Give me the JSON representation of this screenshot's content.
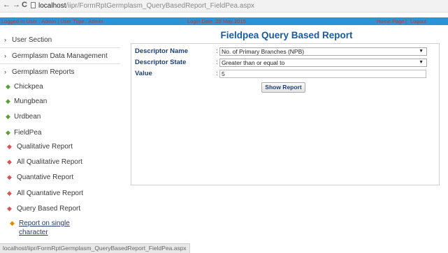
{
  "browser": {
    "back_icon": "back-arrow-icon",
    "forward_icon": "forward-arrow-icon",
    "reload_icon": "reload-icon",
    "back_glyph": "←",
    "forward_glyph": "→",
    "reload_glyph": "C",
    "url_host": "localhost",
    "url_path": "/iipr/FormRptGermplasm_QueryBasedReport_FieldPea.aspx"
  },
  "header": {
    "logged_in": "Logged In User : Admin | User Type : Admin",
    "login_date": "Login Date :29 May 2015",
    "home_link": "Home Page",
    "separator": "|",
    "logout_link": "Logout"
  },
  "sidebar": {
    "user_section": "User Section",
    "germplasm_data_management": "Germplasm Data Management",
    "germplasm_reports": "Germplasm Reports",
    "crops": [
      "Chickpea",
      "Mungbean",
      "Urdbean",
      "FieldPea"
    ],
    "fieldpea_reports": [
      "Qualitative Report",
      "All Qualitative Report",
      "Quantative Report",
      "All Quantative Report",
      "Query Based Report"
    ],
    "report_on_single_line1": "Report on single",
    "report_on_single_line2": "character"
  },
  "main": {
    "title": "Fieldpea Query Based Report",
    "descriptor_name_label": "Descriptor Name",
    "descriptor_state_label": "Descriptor State",
    "value_label": "Value",
    "colon": ":",
    "descriptor_name_value": "No. of Primary Branches (NPB)",
    "descriptor_state_value": "Greater than or equal to",
    "value_input": "5",
    "show_report_button": "Show Report"
  },
  "status_bar": {
    "url": "localhost/iipr/FormRptGermplasm_QueryBasedReport_FieldPea.aspx"
  },
  "colors": {
    "header_bg": "#2c94d6",
    "header_text": "#c0392b",
    "title": "#1d5a9c",
    "label": "#1d3f7a"
  }
}
